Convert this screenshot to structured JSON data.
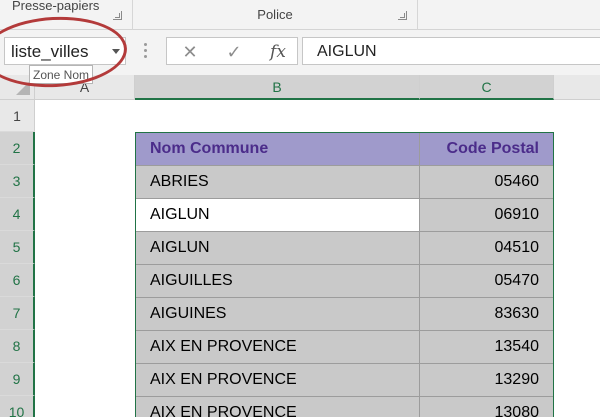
{
  "ribbon": {
    "groups": [
      "Presse-papiers",
      "Police"
    ]
  },
  "formula_bar": {
    "name_box_value": "liste_villes",
    "cancel_icon": "✕",
    "enter_icon": "✓",
    "fx_label": "fx",
    "formula_value": "AIGLUN"
  },
  "tooltip": {
    "text": "Zone Nom"
  },
  "columns": [
    "A",
    "B",
    "C"
  ],
  "rows": [
    "1",
    "2",
    "3",
    "4",
    "5",
    "6",
    "7",
    "8",
    "9",
    "10"
  ],
  "table": {
    "headers": [
      "Nom Commune",
      "Code Postal"
    ],
    "rows": [
      [
        "ABRIES",
        "05460"
      ],
      [
        "AIGLUN",
        "06910"
      ],
      [
        "AIGLUN",
        "04510"
      ],
      [
        "AIGUILLES",
        "05470"
      ],
      [
        "AIGUINES",
        "83630"
      ],
      [
        "AIX EN PROVENCE",
        "13540"
      ],
      [
        "AIX EN PROVENCE",
        "13290"
      ],
      [
        "AIX EN PROVENCE",
        "13080"
      ]
    ]
  },
  "colors": {
    "header_fill": "#9f9acb",
    "header_text": "#4b2c8a",
    "data_fill": "#c9c9c9",
    "selection_accent": "#217346",
    "annotation_ring": "#b33a3a"
  },
  "icons": {
    "name_box_dropdown": "chevron-down-icon",
    "formula_cancel": "close-icon",
    "formula_enter": "check-icon",
    "insert_function": "fx-icon",
    "select_all": "select-all-triangle-icon"
  }
}
